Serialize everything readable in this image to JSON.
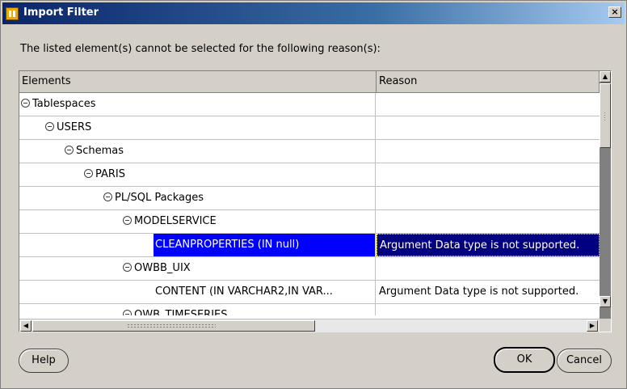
{
  "window": {
    "title": "Import Filter",
    "close_symbol": "×"
  },
  "dialog": {
    "instruction": "The listed element(s) cannot be selected for the following reason(s):"
  },
  "table": {
    "columns": [
      "Elements",
      "Reason"
    ],
    "rows": [
      {
        "element": "Tablespaces",
        "reason": "",
        "expandable": true
      },
      {
        "element": "USERS",
        "reason": "",
        "expandable": true
      },
      {
        "element": "Schemas",
        "reason": "",
        "expandable": true
      },
      {
        "element": "PARIS",
        "reason": "",
        "expandable": true
      },
      {
        "element": "PL/SQL Packages",
        "reason": "",
        "expandable": true
      },
      {
        "element": "MODELSERVICE",
        "reason": "",
        "expandable": true
      },
      {
        "element": "CLEANPROPERTIES (IN null)",
        "reason": "Argument Data type is not supported.",
        "selected": true
      },
      {
        "element": "OWBB_UIX",
        "reason": "",
        "expandable": true
      },
      {
        "element": "CONTENT (IN VARCHAR2,IN VAR...",
        "reason": "Argument Data type is not supported."
      },
      {
        "element": "OWB_TIMESERIES",
        "reason": "",
        "expandable": true
      }
    ]
  },
  "buttons": {
    "help": "Help",
    "ok": "OK",
    "cancel": "Cancel"
  },
  "scrollbars": {
    "up_arrow": "▲",
    "down_arrow": "▼",
    "left_arrow": "◀",
    "right_arrow": "▶"
  }
}
